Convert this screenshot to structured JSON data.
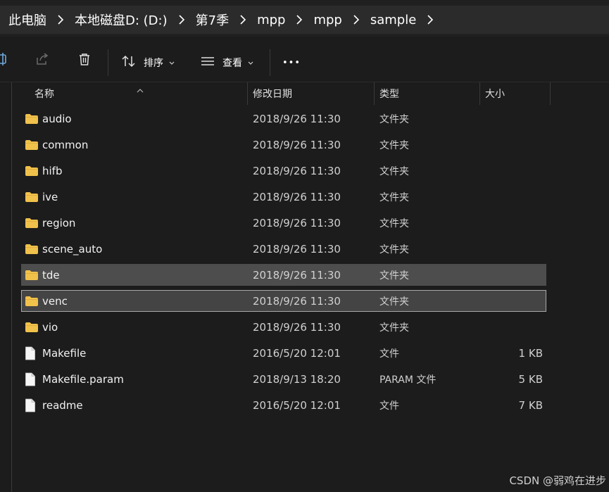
{
  "breadcrumb": {
    "items": [
      {
        "label": "此电脑"
      },
      {
        "label": "本地磁盘D: (D:)"
      },
      {
        "label": "第7季"
      },
      {
        "label": "mpp"
      },
      {
        "label": "mpp"
      },
      {
        "label": "sample"
      }
    ]
  },
  "toolbar": {
    "sort_label": "排序",
    "view_label": "查看",
    "more_label": "•••"
  },
  "columns": {
    "name": "名称",
    "date": "修改日期",
    "type": "类型",
    "size": "大小"
  },
  "files": [
    {
      "name": "audio",
      "date": "2018/9/26 11:30",
      "type": "文件夹",
      "size": "",
      "kind": "folder",
      "state": "normal"
    },
    {
      "name": "common",
      "date": "2018/9/26 11:30",
      "type": "文件夹",
      "size": "",
      "kind": "folder",
      "state": "normal"
    },
    {
      "name": "hifb",
      "date": "2018/9/26 11:30",
      "type": "文件夹",
      "size": "",
      "kind": "folder",
      "state": "normal"
    },
    {
      "name": "ive",
      "date": "2018/9/26 11:30",
      "type": "文件夹",
      "size": "",
      "kind": "folder",
      "state": "normal"
    },
    {
      "name": "region",
      "date": "2018/9/26 11:30",
      "type": "文件夹",
      "size": "",
      "kind": "folder",
      "state": "normal"
    },
    {
      "name": "scene_auto",
      "date": "2018/9/26 11:30",
      "type": "文件夹",
      "size": "",
      "kind": "folder",
      "state": "normal"
    },
    {
      "name": "tde",
      "date": "2018/9/26 11:30",
      "type": "文件夹",
      "size": "",
      "kind": "folder",
      "state": "selected"
    },
    {
      "name": "venc",
      "date": "2018/9/26 11:30",
      "type": "文件夹",
      "size": "",
      "kind": "folder",
      "state": "focused"
    },
    {
      "name": "vio",
      "date": "2018/9/26 11:30",
      "type": "文件夹",
      "size": "",
      "kind": "folder",
      "state": "normal"
    },
    {
      "name": "Makefile",
      "date": "2016/5/20 12:01",
      "type": "文件",
      "size": "1 KB",
      "kind": "file",
      "state": "normal"
    },
    {
      "name": "Makefile.param",
      "date": "2018/9/13 18:20",
      "type": "PARAM 文件",
      "size": "5 KB",
      "kind": "file",
      "state": "normal"
    },
    {
      "name": "readme",
      "date": "2016/5/20 12:01",
      "type": "文件",
      "size": "7 KB",
      "kind": "file",
      "state": "normal"
    }
  ],
  "watermark": "CSDN @弱鸡在进步",
  "colors": {
    "folder": "#f0c14b",
    "selected_bg": "#4d4d4d",
    "focused_border": "#a8a8a8"
  }
}
